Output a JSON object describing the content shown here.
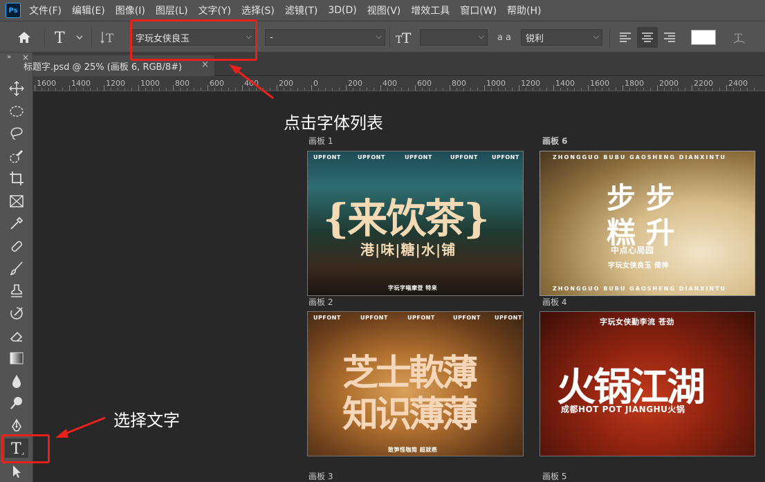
{
  "app": {
    "logo": "Ps"
  },
  "menu": [
    "文件(F)",
    "编辑(E)",
    "图像(I)",
    "图层(L)",
    "文字(Y)",
    "选择(S)",
    "滤镜(T)",
    "3D(D)",
    "视图(V)",
    "增效工具",
    "窗口(W)",
    "帮助(H)"
  ],
  "options": {
    "font_family": "字玩女侠良玉",
    "font_style": "-",
    "font_size": "",
    "aa_label": "a a",
    "anti_alias": "锐利",
    "color_swatch": "#ffffff"
  },
  "tab": {
    "title": "标题字.psd @ 25% (画板 6, RGB/8#)",
    "close": "×"
  },
  "panel": {
    "collapse": "»",
    "close": "×"
  },
  "ruler": [
    "1600",
    "1400",
    "1200",
    "1000",
    "800",
    "600",
    "400",
    "200",
    "0",
    "200",
    "400",
    "600",
    "800",
    "1000",
    "1200",
    "1400",
    "1600",
    "1800",
    "2000",
    "2200",
    "2400"
  ],
  "artboards": {
    "ab1": {
      "label": "画板 1",
      "upfont": [
        "UPFONT",
        "UPFONT",
        "UPFONT",
        "UPFONT",
        "UPFONT"
      ],
      "title": "{来饮茶}",
      "subtitle": "港|味|糖|水|铺",
      "footer": "字玩字喵摩登 特来"
    },
    "ab6": {
      "label": "画板 6",
      "top": "ZHONGGUO BUBU GAOSHENG DIANXINTU",
      "title_line1": "步 步",
      "title_line2": "糕 升",
      "tagline": "中点心局园",
      "font_note": "字玩女侠良玉 倚抻",
      "bottom": "ZHONGGUO BUBU GAOSHENG DIANXINTU"
    },
    "ab2": {
      "label": "画板 2",
      "upfont": [
        "UPFONT",
        "UPFONT",
        "UPFONT",
        "UPFONT",
        "UPFONT"
      ],
      "title_line1": "芝士軟薄",
      "title_line2": "知识薄薄",
      "footer": "致笋怪咖简 超就燕"
    },
    "ab4": {
      "label": "画板 4",
      "top": "字玩女侠勤李流 苍劲",
      "title": "火锅江湖",
      "subtitle": "成都HOT POT JIANGHU火锅"
    },
    "ab3_label": "画板 3",
    "ab5_label": "画板 5"
  },
  "annotations": {
    "font_list": "点击字体列表",
    "select_text": "选择文字",
    "color": "#e8221b"
  }
}
